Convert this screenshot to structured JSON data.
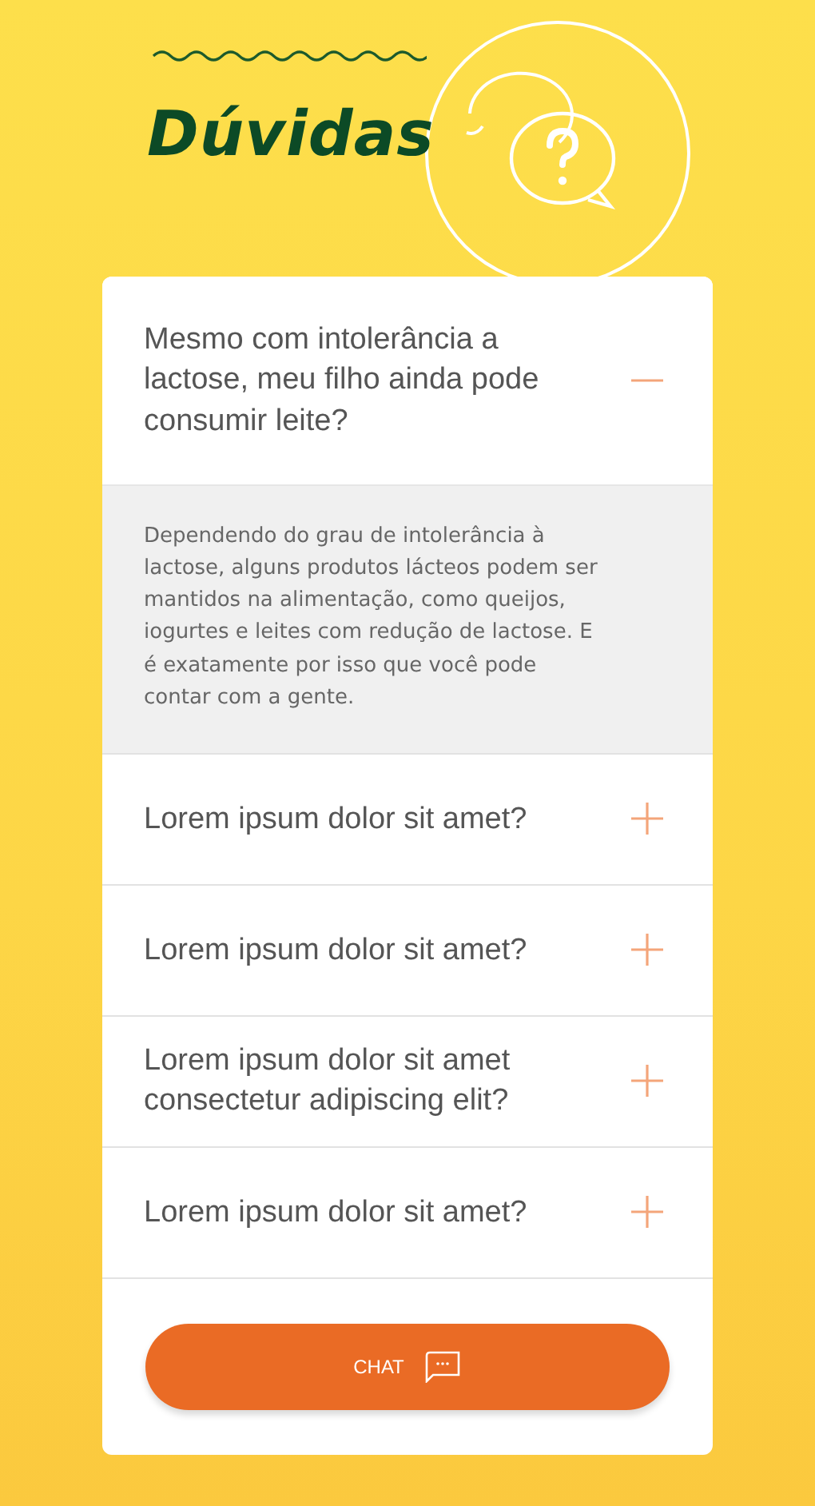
{
  "title": "Dúvidas",
  "faq": [
    {
      "question": "Mesmo com intolerância a lactose, meu filho ainda pode consumir leite?",
      "expanded": true,
      "answer": "Dependendo do grau de intolerância à lactose, alguns produtos lácteos podem ser mantidos na alimentação, como queijos, iogurtes e leites com redução de lactose. E é exatamente por isso que você pode contar com a gente."
    },
    {
      "question": "Lorem ipsum dolor sit amet?",
      "expanded": false
    },
    {
      "question": "Lorem ipsum dolor sit amet?",
      "expanded": false
    },
    {
      "question": "Lorem ipsum dolor sit amet consectetur adipiscing elit?",
      "expanded": false
    },
    {
      "question": "Lorem ipsum dolor sit amet?",
      "expanded": false
    }
  ],
  "chat_button": {
    "label": "CHAT"
  }
}
